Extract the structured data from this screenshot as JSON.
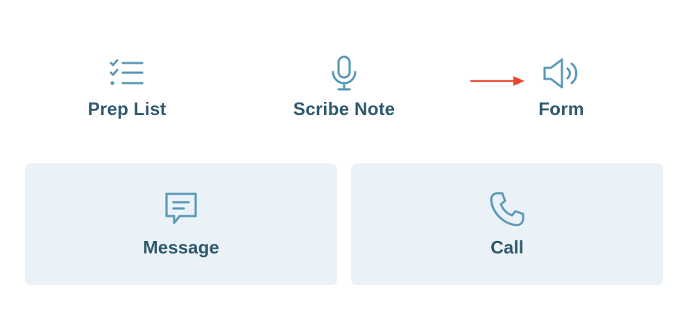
{
  "actions": [
    {
      "label": "Prep List",
      "icon": "checklist-icon"
    },
    {
      "label": "Scribe Note",
      "icon": "microphone-icon"
    },
    {
      "label": "Form",
      "icon": "speaker-icon"
    }
  ],
  "cards": [
    {
      "label": "Message",
      "icon": "message-icon"
    },
    {
      "label": "Call",
      "icon": "phone-icon"
    }
  ],
  "colors": {
    "icon": "#5b9ab8",
    "label": "#2e5a6e",
    "card_bg": "#ebf2f7",
    "arrow": "#e8432e"
  }
}
